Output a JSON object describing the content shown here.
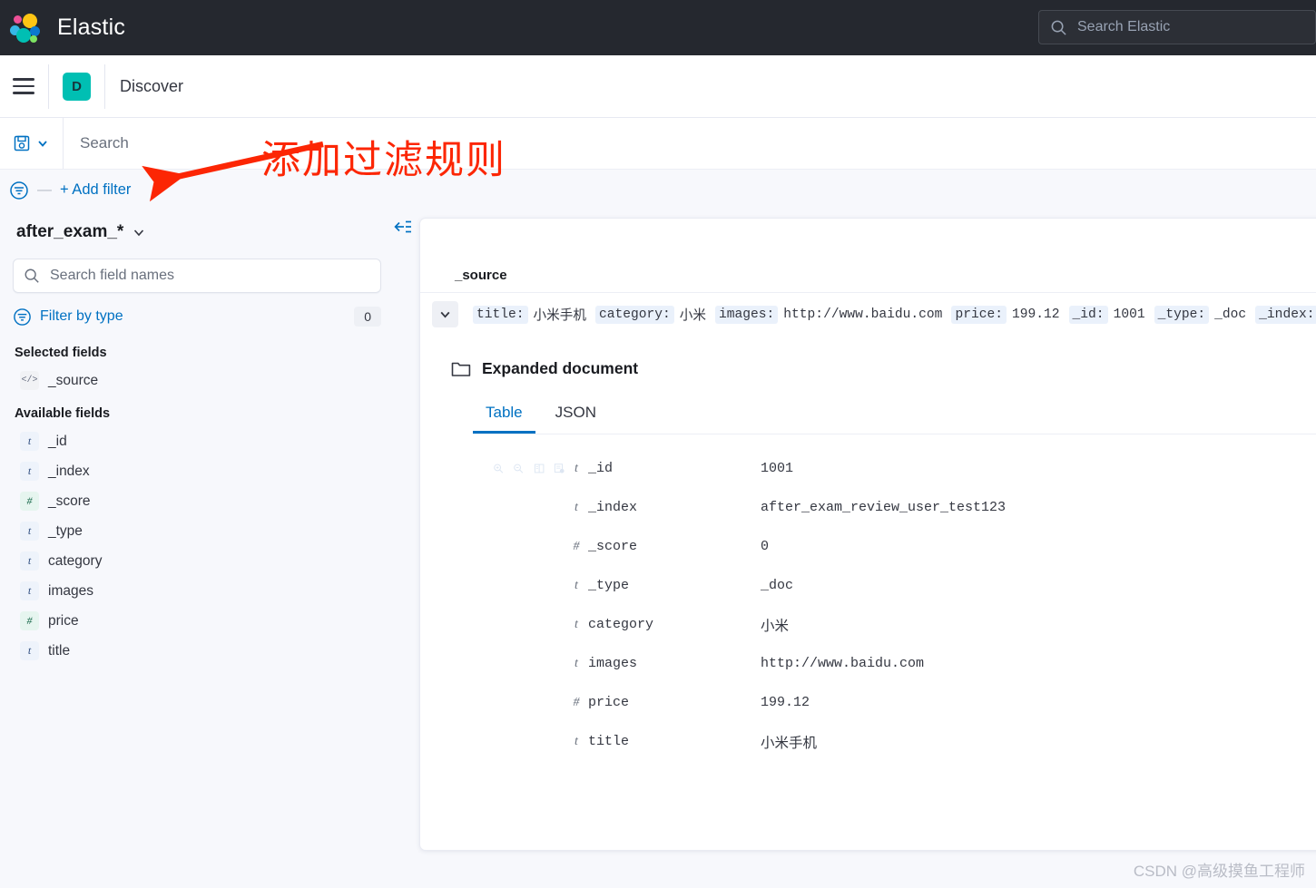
{
  "header": {
    "brand": "Elastic",
    "logo_icon": "elastic-logo",
    "search": {
      "placeholder": "Search Elastic",
      "icon": "search-icon",
      "value": ""
    },
    "bg_color": "#25282f"
  },
  "navbar": {
    "menu_icon": "hamburger-menu-icon",
    "app_badge": "D",
    "app_badge_color": "#00bfb3",
    "breadcrumb": "Discover"
  },
  "querybar": {
    "saved_query_icon": "save-icon",
    "saved_query_chevron": "chevron-down-icon",
    "search_placeholder": "Search",
    "search_value": ""
  },
  "filterbar": {
    "filter_icon": "filter-settings-icon",
    "separator": "—",
    "add_filter_label": "+ Add filter",
    "link_color": "#0071c2"
  },
  "sidebar": {
    "index_pattern": "after_exam_*",
    "index_chevron": "chevron-down-icon",
    "field_search_placeholder": "Search field names",
    "field_search_value": "",
    "filter_by_type_label": "Filter by type",
    "filter_by_type_count": "0",
    "selected_fields_title": "Selected fields",
    "selected_fields": [
      {
        "name": "_source",
        "type": "source",
        "type_glyph": "</>"
      }
    ],
    "available_fields_title": "Available fields",
    "available_fields": [
      {
        "name": "_id",
        "type": "string",
        "type_glyph": "t"
      },
      {
        "name": "_index",
        "type": "string",
        "type_glyph": "t"
      },
      {
        "name": "_score",
        "type": "number",
        "type_glyph": "#"
      },
      {
        "name": "_type",
        "type": "string",
        "type_glyph": "t"
      },
      {
        "name": "category",
        "type": "string",
        "type_glyph": "t"
      },
      {
        "name": "images",
        "type": "string",
        "type_glyph": "t"
      },
      {
        "name": "price",
        "type": "number",
        "type_glyph": "#"
      },
      {
        "name": "title",
        "type": "string",
        "type_glyph": "t"
      }
    ],
    "collapse_icon": "collapse-sidebar-icon"
  },
  "doc_panel": {
    "column_header": "_source",
    "expand_icon": "chevron-down-icon",
    "source_summary": [
      {
        "key": "title:",
        "value": "小米手机"
      },
      {
        "key": "category:",
        "value": "小米"
      },
      {
        "key": "images:",
        "value": "http://www.baidu.com"
      },
      {
        "key": "price:",
        "value": "199.12"
      },
      {
        "key": "_id:",
        "value": "1001"
      },
      {
        "key": "_type:",
        "value": "_doc"
      },
      {
        "key": "_index:",
        "value": ""
      }
    ],
    "expanded": {
      "folder_icon": "folder-open-icon",
      "title": "Expanded document",
      "tabs": [
        {
          "label": "Table",
          "active": true
        },
        {
          "label": "JSON",
          "active": false
        }
      ],
      "row_actions": [
        "filter-for-value-icon",
        "filter-out-value-icon",
        "toggle-column-in-table-icon",
        "filter-for-field-present-icon"
      ],
      "rows": [
        {
          "type_glyph": "t",
          "field": "_id",
          "value": "1001",
          "cjk": false
        },
        {
          "type_glyph": "t",
          "field": "_index",
          "value": "after_exam_review_user_test123",
          "cjk": false
        },
        {
          "type_glyph": "#",
          "field": "_score",
          "value": "0",
          "cjk": false
        },
        {
          "type_glyph": "t",
          "field": "_type",
          "value": "_doc",
          "cjk": false
        },
        {
          "type_glyph": "t",
          "field": "category",
          "value": "小米",
          "cjk": true
        },
        {
          "type_glyph": "t",
          "field": "images",
          "value": "http://www.baidu.com",
          "cjk": false
        },
        {
          "type_glyph": "#",
          "field": "price",
          "value": "199.12",
          "cjk": false
        },
        {
          "type_glyph": "t",
          "field": "title",
          "value": "小米手机",
          "cjk": true
        }
      ]
    }
  },
  "annotation": {
    "text": "添加过滤规则",
    "color": "#fc2604",
    "arrow": "red-arrow-pointing-to-add-filter"
  },
  "watermark": "CSDN @高级摸鱼工程师"
}
